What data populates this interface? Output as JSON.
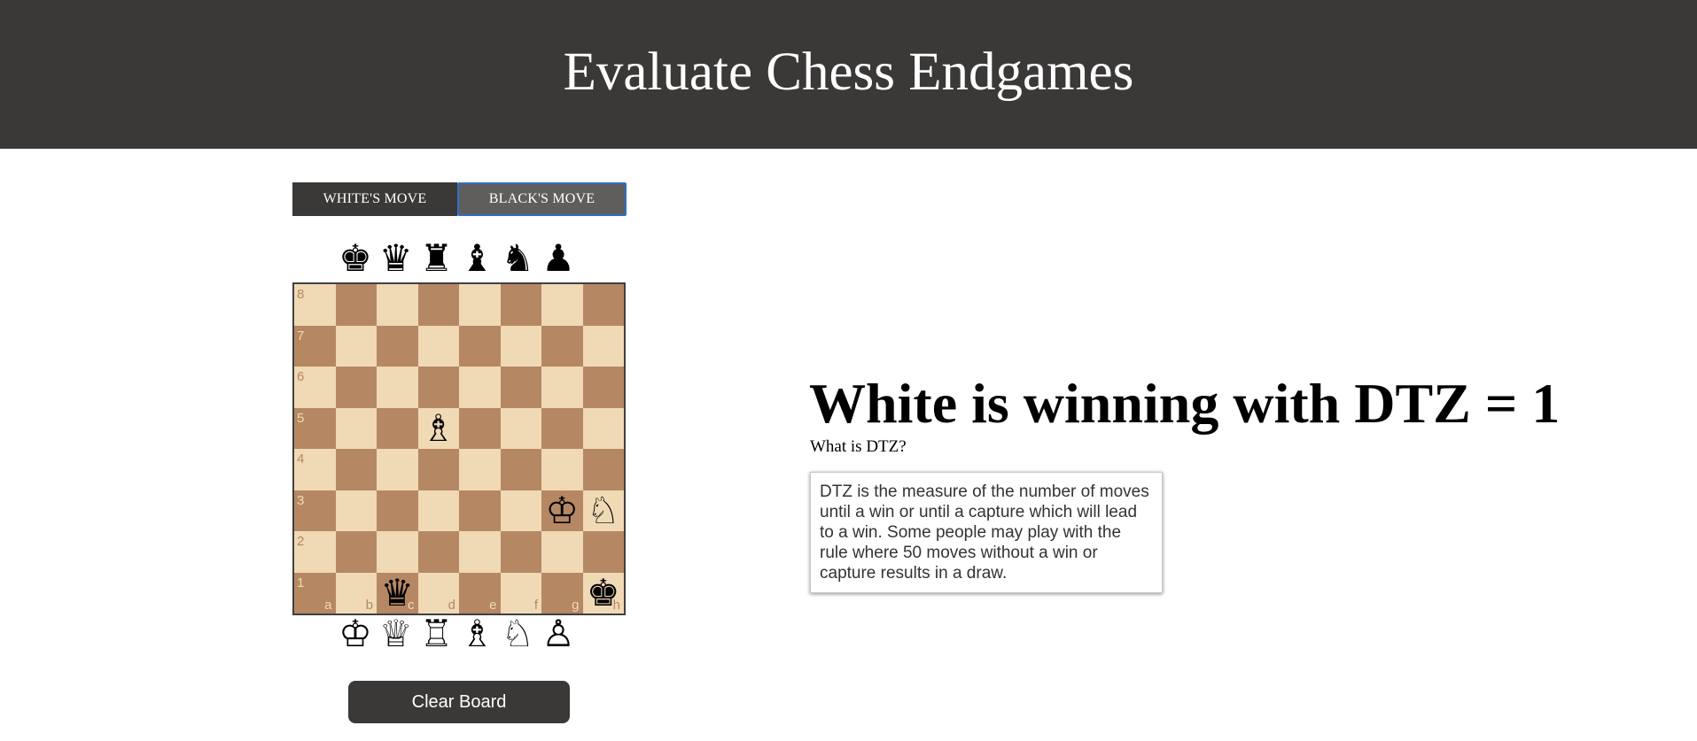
{
  "header": {
    "title": "Evaluate Chess Endgames"
  },
  "tabs": {
    "white_label": "WHITE'S MOVE",
    "black_label": "BLACK'S MOVE",
    "active": "black"
  },
  "spare_black": [
    {
      "name": "king",
      "glyph": "♚"
    },
    {
      "name": "queen",
      "glyph": "♛"
    },
    {
      "name": "rook",
      "glyph": "♜"
    },
    {
      "name": "bishop",
      "glyph": "♝"
    },
    {
      "name": "knight",
      "glyph": "♞"
    },
    {
      "name": "pawn",
      "glyph": "♟"
    }
  ],
  "spare_white": [
    {
      "name": "king",
      "glyph": "♔"
    },
    {
      "name": "queen",
      "glyph": "♕"
    },
    {
      "name": "rook",
      "glyph": "♖"
    },
    {
      "name": "bishop",
      "glyph": "♗"
    },
    {
      "name": "knight",
      "glyph": "♘"
    },
    {
      "name": "pawn",
      "glyph": "♙"
    }
  ],
  "board": {
    "ranks": [
      "8",
      "7",
      "6",
      "5",
      "4",
      "3",
      "2",
      "1"
    ],
    "files": [
      "a",
      "b",
      "c",
      "d",
      "e",
      "f",
      "g",
      "h"
    ],
    "colors": {
      "light": "#f0d9b5",
      "dark": "#b58863"
    },
    "pieces": [
      {
        "square": "d5",
        "glyph": "♗",
        "name": "white-bishop"
      },
      {
        "square": "g3",
        "glyph": "♔",
        "name": "white-king"
      },
      {
        "square": "h3",
        "glyph": "♘",
        "name": "white-knight"
      },
      {
        "square": "c1",
        "glyph": "♛",
        "name": "black-queen"
      },
      {
        "square": "h1",
        "glyph": "♚",
        "name": "black-king"
      }
    ]
  },
  "clear_button": {
    "label": "Clear Board"
  },
  "result": {
    "headline": "White is winning with DTZ = 1",
    "question": "What is DTZ?",
    "explanation": "DTZ is the measure of the number of moves until a win or until a capture which will lead to a win. Some people may play with the rule where 50 moves without a win or capture results in a draw."
  },
  "colors": {
    "header_bg": "#3b3938",
    "tab_active_border": "#2f6ec9"
  }
}
